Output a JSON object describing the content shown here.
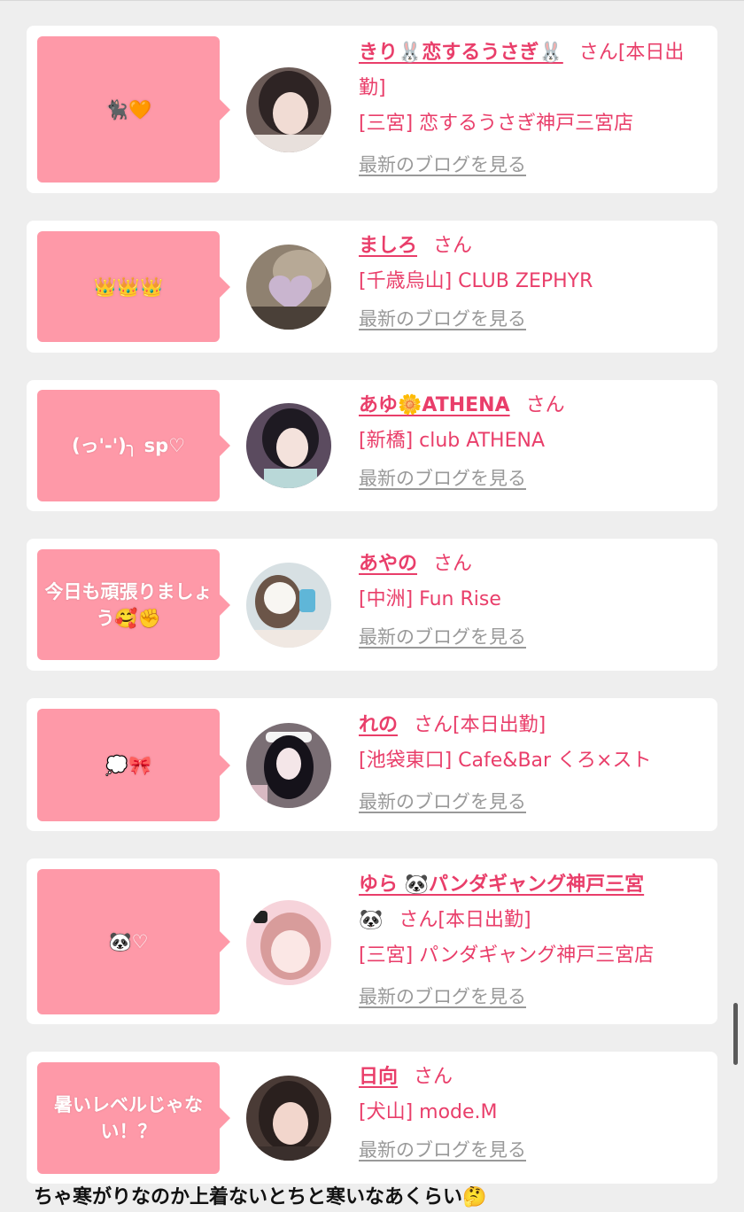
{
  "cards": [
    {
      "bubble": "🐈‍⬛🧡",
      "name": "きり🐰恋するうさぎ🐰",
      "san": "さん",
      "status": "[本日出勤]",
      "shop": "[三宮] 恋するうさぎ神戸三宮店",
      "blog": "最新のブログを見る",
      "avatar_color": "#4a3d3d"
    },
    {
      "bubble": "👑👑👑",
      "name": "ましろ",
      "san": "さん",
      "status": "",
      "shop": "[千歳烏山] CLUB ZEPHYR",
      "blog": "最新のブログを見る",
      "avatar_color": "#8a7a6a"
    },
    {
      "bubble": "(っ'-')╮ sp♡",
      "name": "あゆ🌼ATHENA",
      "san": "さん",
      "status": "",
      "shop": "[新橋] club ATHENA",
      "blog": "最新のブログを見る",
      "avatar_color": "#5a4a5a"
    },
    {
      "bubble": "今日も頑張りましょう🥰✊",
      "name": "あやの",
      "san": "さん",
      "status": "",
      "shop": "[中洲] Fun Rise",
      "blog": "最新のブログを見る",
      "avatar_color": "#cfd8dc"
    },
    {
      "bubble": "💭🎀",
      "name": "れの",
      "san": "さん",
      "status": "[本日出勤]",
      "shop": "[池袋東口] Cafe&Bar くろ×スト",
      "blog": "最新のブログを見る",
      "avatar_color": "#3a3035"
    },
    {
      "bubble": "🐼♡",
      "name": "ゆら 🐼パンダギャング神戸三宮",
      "name_tail": "🐼",
      "san": "さん",
      "status": "[本日出勤]",
      "shop": "[三宮] パンダギャング神戸三宮店",
      "blog": "最新のブログを見る",
      "avatar_color": "#f3c6cf"
    },
    {
      "bubble": "暑いレベルじゃない！？",
      "name": "日向",
      "san": "さん",
      "status": "",
      "shop": "[犬山] mode.M",
      "blog": "最新のブログを見る",
      "avatar_color": "#3a2e2a"
    }
  ],
  "footer_text": "ちゃ寒がりなのか上着ないとちと寒いなあくらい🤔",
  "colors": {
    "accent": "#e93e6a",
    "bubble": "#fe99a8",
    "link_gray": "#999999",
    "page_bg": "#eeeeee"
  }
}
